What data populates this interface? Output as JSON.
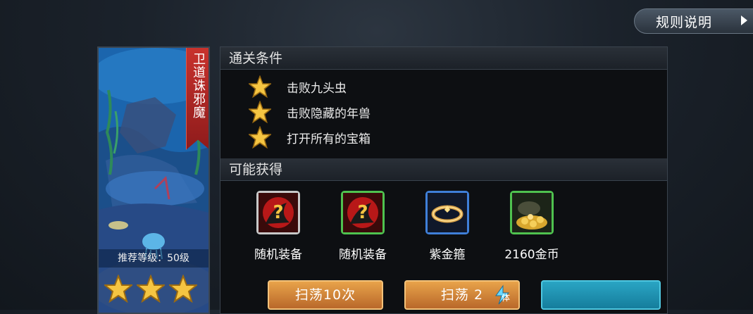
{
  "header": {
    "rules_label": "规则说明"
  },
  "stage": {
    "banner_title": "卫道诛邪魔",
    "recommended_level": "推荐等级：50级",
    "stars_earned": 3,
    "stars_total": 3
  },
  "conditions": {
    "title": "通关条件",
    "items": [
      {
        "label": "击败九头虫"
      },
      {
        "label": "击败隐藏的年兽"
      },
      {
        "label": "打开所有的宝箱"
      }
    ]
  },
  "rewards": {
    "title": "可能获得",
    "items": [
      {
        "label": "随机装备",
        "icon": "mystery-equipment-icon",
        "frame_color": "#c8c8c8"
      },
      {
        "label": "随机装备",
        "icon": "mystery-equipment-icon",
        "frame_color": "#4fc24f"
      },
      {
        "label": "紫金箍",
        "icon": "golden-ring-icon",
        "frame_color": "#3f7fd8"
      },
      {
        "label": "2160金币",
        "icon": "gold-coins-icon",
        "frame_color": "#4fc24f"
      }
    ]
  },
  "actions": {
    "sweep10_label": "扫荡10次",
    "sweep_label": "扫荡 2",
    "stamina_badge": "体"
  },
  "colors": {
    "accent_orange": "#e8a34a",
    "banner_red": "#c8322d",
    "star_gold": "#f5c542"
  }
}
